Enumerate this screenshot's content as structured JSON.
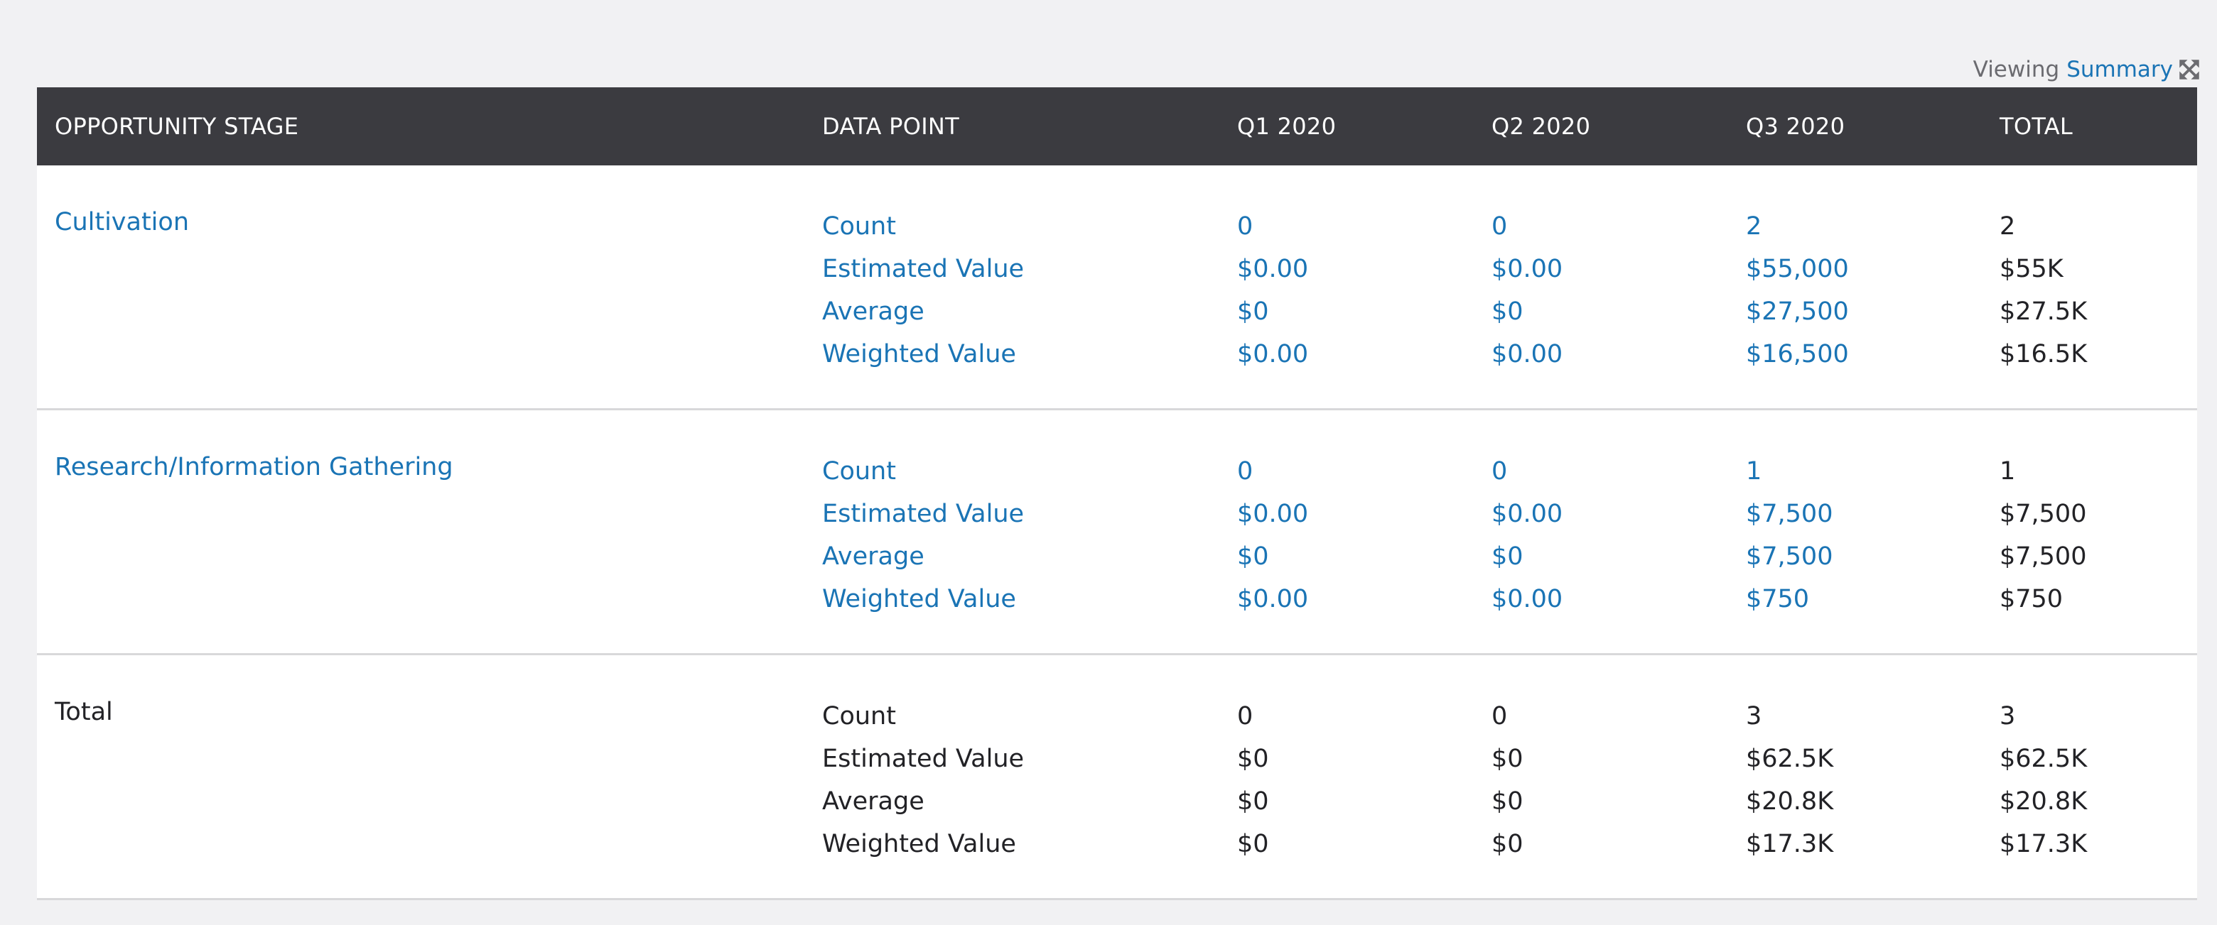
{
  "viewing": {
    "label": "Viewing",
    "link": "Summary",
    "expand_icon": "expand-arrows-icon"
  },
  "colors": {
    "header_bg": "#3b3b40",
    "link": "#1a74b5",
    "text": "#222226",
    "page_bg": "#f1f1f3"
  },
  "table": {
    "columns": [
      "OPPORTUNITY STAGE",
      "DATA POINT",
      "Q1 2020",
      "Q2 2020",
      "Q3 2020",
      "TOTAL"
    ],
    "sections": [
      {
        "stage": "Cultivation",
        "data_points": [
          "Count",
          "Estimated Value",
          "Average",
          "Weighted Value"
        ],
        "q1": [
          "0",
          "$0.00",
          "$0",
          "$0.00"
        ],
        "q2": [
          "0",
          "$0.00",
          "$0",
          "$0.00"
        ],
        "q3": [
          "2",
          "$55,000",
          "$27,500",
          "$16,500"
        ],
        "total": [
          "2",
          "$55K",
          "$27.5K",
          "$16.5K"
        ]
      },
      {
        "stage": "Research/Information Gathering",
        "data_points": [
          "Count",
          "Estimated Value",
          "Average",
          "Weighted Value"
        ],
        "q1": [
          "0",
          "$0.00",
          "$0",
          "$0.00"
        ],
        "q2": [
          "0",
          "$0.00",
          "$0",
          "$0.00"
        ],
        "q3": [
          "1",
          "$7,500",
          "$7,500",
          "$750"
        ],
        "total": [
          "1",
          "$7,500",
          "$7,500",
          "$750"
        ]
      },
      {
        "stage": "Total",
        "data_points": [
          "Count",
          "Estimated Value",
          "Average",
          "Weighted Value"
        ],
        "q1": [
          "0",
          "$0",
          "$0",
          "$0"
        ],
        "q2": [
          "0",
          "$0",
          "$0",
          "$0"
        ],
        "q3": [
          "3",
          "$62.5K",
          "$20.8K",
          "$17.3K"
        ],
        "total": [
          "3",
          "$62.5K",
          "$20.8K",
          "$17.3K"
        ]
      }
    ]
  }
}
